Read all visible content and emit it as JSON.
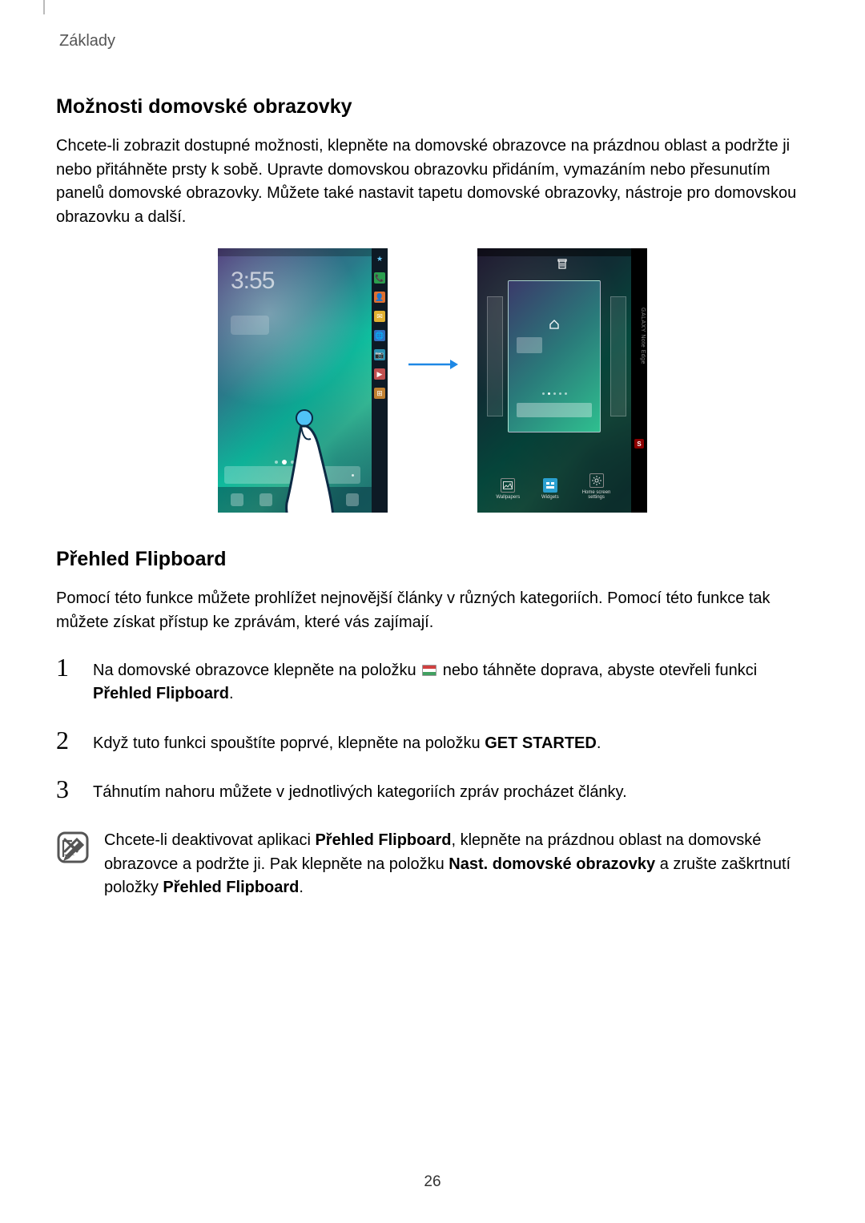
{
  "running_head": "Základy",
  "section1": {
    "title": "Možnosti domovské obrazovky",
    "body": "Chcete-li zobrazit dostupné možnosti, klepněte na domovské obrazovce na prázdnou oblast a podržte ji nebo přitáhněte prsty k sobě. Upravte domovskou obrazovku přidáním, vymazáním nebo přesunutím panelů domovské obrazovky. Můžete také nastavit tapetu domovské obrazovky, nástroje pro domovskou obrazovku a další."
  },
  "figure": {
    "phone1": {
      "clock": "3:55",
      "edge_star": "★",
      "edge_phone": "📞",
      "edge_contact": "👤",
      "edge_mail": "✉",
      "edge_globe": "🌐",
      "edge_cam": "📷",
      "edge_video": "▶",
      "edge_grid": "⊞"
    },
    "phone2": {
      "edge_brand": "GALAXY Note Edge",
      "s_label": "S",
      "action_wallpapers": "Wallpapers",
      "action_widgets": "Widgets",
      "action_settings": "Home screen settings"
    }
  },
  "section2": {
    "title": "Přehled Flipboard",
    "body": "Pomocí této funkce můžete prohlížet nejnovější články v různých kategoriích. Pomocí této funkce tak můžete získat přístup ke zprávám, které vás zajímají."
  },
  "steps": {
    "s1_num": "1",
    "s1_a": "Na domovské obrazovce klepněte na položku ",
    "s1_b": " nebo táhněte doprava, abyste otevřeli funkci ",
    "s1_bold": "Přehled Flipboard",
    "s1_c": ".",
    "s2_num": "2",
    "s2_a": "Když tuto funkci spouštíte poprvé, klepněte na položku ",
    "s2_bold": "GET STARTED",
    "s2_b": ".",
    "s3_num": "3",
    "s3_a": "Táhnutím nahoru můžete v jednotlivých kategoriích zpráv procházet články."
  },
  "note": {
    "a": "Chcete-li deaktivovat aplikaci ",
    "bold1": "Přehled Flipboard",
    "b": ", klepněte na prázdnou oblast na domovské obrazovce a podržte ji. Pak klepněte na položku ",
    "bold2": "Nast. domovské obrazovky",
    "c": " a zrušte zaškrtnutí položky ",
    "bold3": "Přehled Flipboard",
    "d": "."
  },
  "page_number": "26"
}
